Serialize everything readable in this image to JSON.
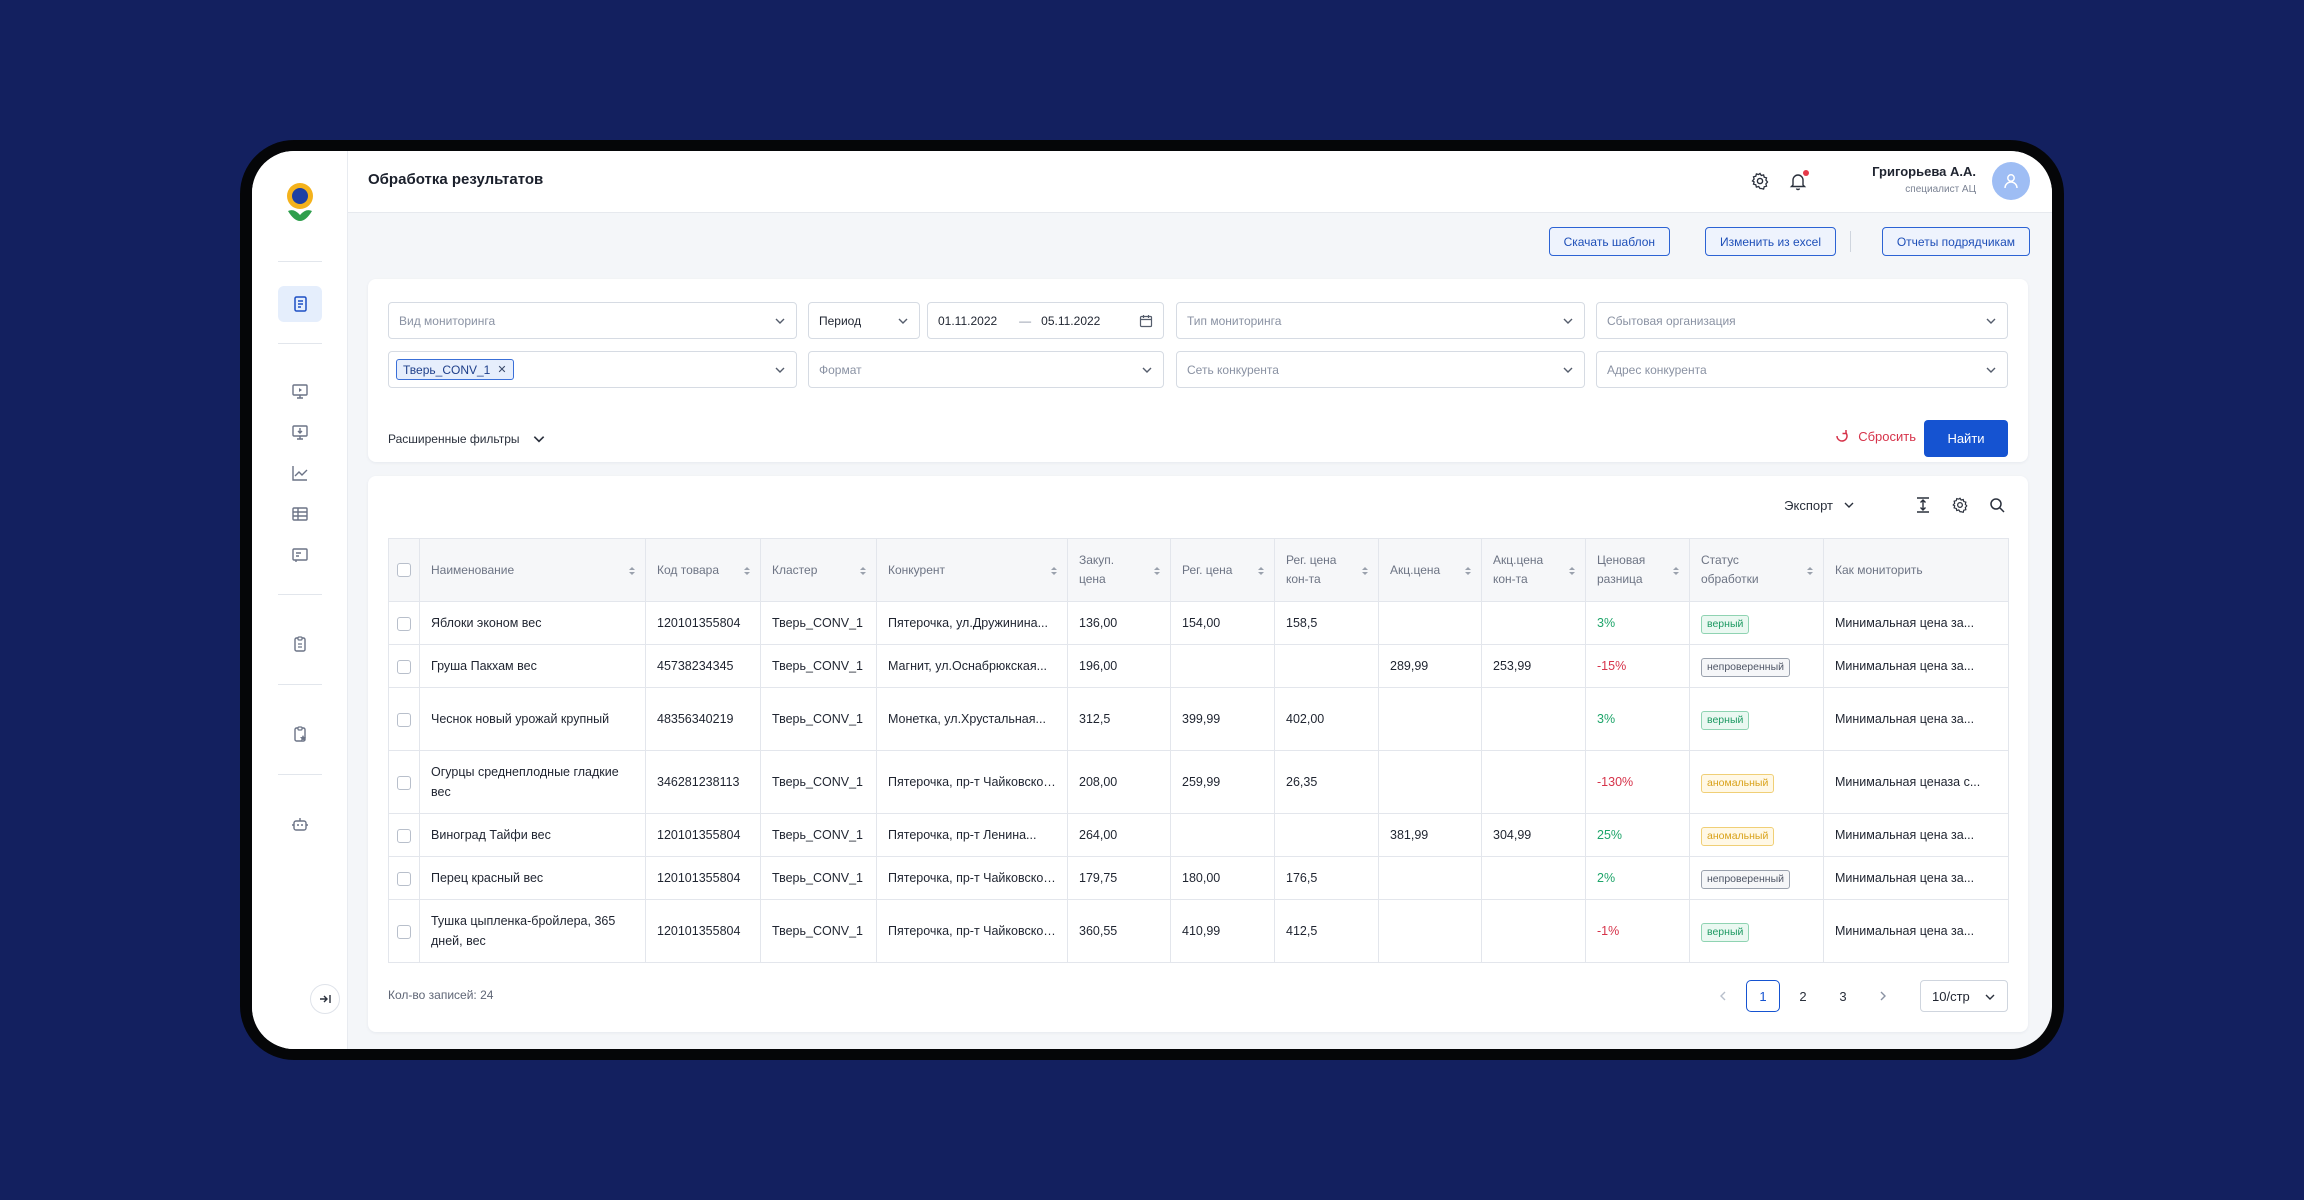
{
  "header": {
    "title": "Обработка результатов",
    "user_name": "Григорьева А.А.",
    "user_role": "специалист АЦ"
  },
  "actions": {
    "download_template": "Скачать шаблон",
    "edit_from_excel": "Изменить из excel",
    "contractor_reports": "Отчеты подрядчикам"
  },
  "filters": {
    "monitoring_view_placeholder": "Вид мониторинга",
    "period_label": "Период",
    "date_from": "01.11.2022",
    "date_sep": "—",
    "date_to": "05.11.2022",
    "monitoring_type_placeholder": "Тип мониторинга",
    "sales_org_placeholder": "Сбытовая организация",
    "cluster_tag": "Тверь_CONV_1",
    "format_placeholder": "Формат",
    "competitor_network_placeholder": "Сеть конкурента",
    "competitor_address_placeholder": "Адрес конкурента",
    "advanced_label": "Расширенные фильтры",
    "reset_label": "Сбросить",
    "find_label": "Найти"
  },
  "table_tools": {
    "export_label": "Экспорт"
  },
  "table": {
    "columns": [
      {
        "l1": "Наименование",
        "l2": ""
      },
      {
        "l1": "Код товара",
        "l2": ""
      },
      {
        "l1": "Кластер",
        "l2": ""
      },
      {
        "l1": "Конкурент",
        "l2": ""
      },
      {
        "l1": "Закуп.",
        "l2": "цена"
      },
      {
        "l1": "Рег. цена",
        "l2": ""
      },
      {
        "l1": "Рег. цена",
        "l2": "кон-та"
      },
      {
        "l1": "Акц.цена",
        "l2": ""
      },
      {
        "l1": "Акц.цена",
        "l2": "кон-та"
      },
      {
        "l1": "Ценовая",
        "l2": "разница"
      },
      {
        "l1": "Статус",
        "l2": "обработки"
      },
      {
        "l1": "Как мониторить",
        "l2": ""
      }
    ],
    "rows": [
      {
        "name": "Яблоки эконом вес",
        "code": "120101355804",
        "cluster": "Тверь_CONV_1",
        "competitor": "Пятерочка, ул.Дружинина...",
        "purchase": "136,00",
        "reg": "154,00",
        "reg_comp": "158,5",
        "promo": "",
        "promo_comp": "",
        "diff": "3%",
        "diff_sign": "pos",
        "status": "верный",
        "status_type": "b-ok",
        "how": "Минимальная цена за..."
      },
      {
        "name": "Груша Пакхам вес",
        "code": "45738234345",
        "cluster": "Тверь_CONV_1",
        "competitor": "Магнит, ул.Оснабрюкская...",
        "purchase": "196,00",
        "reg": "",
        "reg_comp": "",
        "promo": "289,99",
        "promo_comp": "253,99",
        "diff": "-15%",
        "diff_sign": "neg",
        "status": "непроверенный",
        "status_type": "b-unv",
        "how": "Минимальная цена за..."
      },
      {
        "name": "Чеснок новый урожай крупный",
        "code": "48356340219",
        "cluster": "Тверь_CONV_1",
        "competitor": "Монетка, ул.Хрустальная...",
        "purchase": "312,5",
        "reg": "399,99",
        "reg_comp": "402,00",
        "promo": "",
        "promo_comp": "",
        "diff": "3%",
        "diff_sign": "pos",
        "status": "верный",
        "status_type": "b-ok",
        "how": "Минимальная цена за..."
      },
      {
        "name": "Огурцы среднеплодные гладкие вес",
        "code": "346281238113",
        "cluster": "Тверь_CONV_1",
        "competitor": "Пятерочка, пр-т Чайковского...",
        "purchase": "208,00",
        "reg": "259,99",
        "reg_comp": "26,35",
        "promo": "",
        "promo_comp": "",
        "diff": "-130%",
        "diff_sign": "neg",
        "status": "аномальный",
        "status_type": "b-anom",
        "how": "Минимальная ценаза с..."
      },
      {
        "name": "Виноград Тайфи вес",
        "code": "120101355804",
        "cluster": "Тверь_CONV_1",
        "competitor": "Пятерочка, пр-т Ленина...",
        "purchase": "264,00",
        "reg": "",
        "reg_comp": "",
        "promo": "381,99",
        "promo_comp": "304,99",
        "diff": "25%",
        "diff_sign": "pos",
        "status": "аномальный",
        "status_type": "b-anom",
        "how": "Минимальная цена за..."
      },
      {
        "name": "Перец красный вес",
        "code": "120101355804",
        "cluster": "Тверь_CONV_1",
        "competitor": "Пятерочка, пр-т Чайковского...",
        "purchase": "179,75",
        "reg": "180,00",
        "reg_comp": "176,5",
        "promo": "",
        "promo_comp": "",
        "diff": "2%",
        "diff_sign": "pos",
        "status": "непроверенный",
        "status_type": "b-unv",
        "how": "Минимальная цена за..."
      },
      {
        "name": "Тушка цыпленка-бройлера, 365 дней, вес",
        "code": "120101355804",
        "cluster": "Тверь_CONV_1",
        "competitor": "Пятерочка, пр-т Чайковского...",
        "purchase": "360,55",
        "reg": "410,99",
        "reg_comp": "412,5",
        "promo": "",
        "promo_comp": "",
        "diff": "-1%",
        "diff_sign": "neg",
        "status": "верный",
        "status_type": "b-ok",
        "how": "Минимальная цена за..."
      }
    ]
  },
  "footer": {
    "records_count": "Кол-во записей: 24",
    "pages": [
      "1",
      "2",
      "3"
    ],
    "current_page": "1",
    "per_page": "10/стр"
  },
  "colors": {
    "background": "#13205f",
    "primary": "#1553d1",
    "positive": "#1ea56a",
    "negative": "#d6334a",
    "warning": "#d9a21b"
  },
  "icons": {
    "sidebar": [
      "documents-icon",
      "monitor-play-icon",
      "monitor-download-icon",
      "chart-line-icon",
      "table-icon",
      "report-icon",
      "clipboard-icon",
      "clipboard-star-icon",
      "robot-icon"
    ],
    "topbar": [
      "gear-icon",
      "bell-icon",
      "user-icon"
    ]
  }
}
